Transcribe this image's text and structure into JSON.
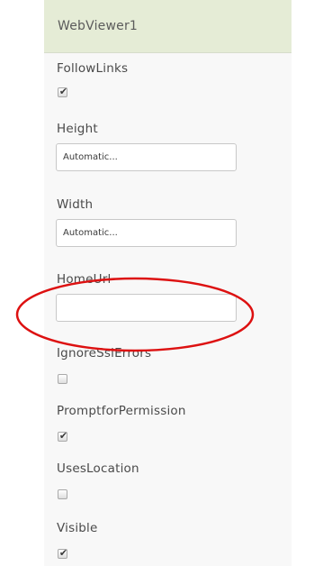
{
  "component": {
    "title": "WebViewer1"
  },
  "properties": {
    "follow_links": {
      "label": "FollowLinks",
      "checked": true
    },
    "height": {
      "label": "Height",
      "value": "Automatic..."
    },
    "width": {
      "label": "Width",
      "value": "Automatic..."
    },
    "home_url": {
      "label": "HomeUrl",
      "value": ""
    },
    "ignore_ssl_errors": {
      "label": "IgnoreSslErrors",
      "checked": false
    },
    "prompt_for_permission": {
      "label": "PromptforPermission",
      "checked": true
    },
    "uses_location": {
      "label": "UsesLocation",
      "checked": false
    },
    "visible": {
      "label": "Visible",
      "checked": true
    }
  },
  "checkmark_glyph": "✔",
  "colors": {
    "header_bg": "#e5ecd6",
    "panel_bg": "#f8f8f8",
    "annotation_circle": "#dd1111"
  }
}
